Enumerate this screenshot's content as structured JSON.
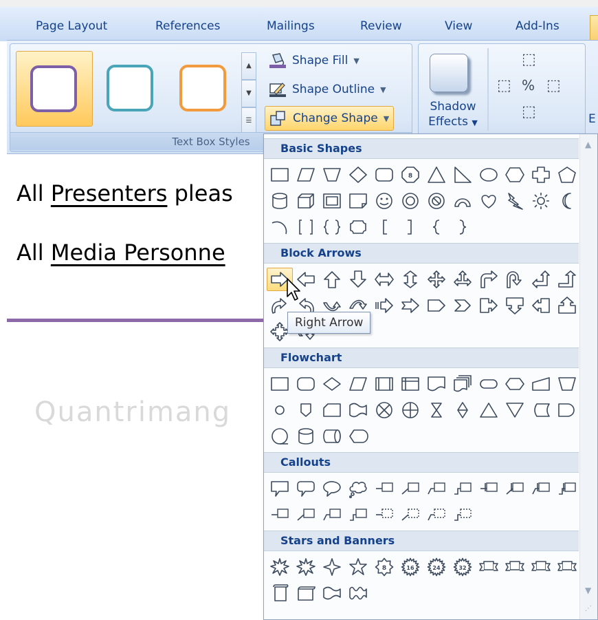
{
  "ribbon": {
    "tabs": [
      "Page Layout",
      "References",
      "Mailings",
      "Review",
      "View",
      "Add-Ins"
    ],
    "text_box_styles": {
      "label": "Text Box Styles",
      "thumbnails": [
        {
          "name": "purple-outline-style",
          "border": "#7d5fa8"
        },
        {
          "name": "teal-outline-style",
          "border": "#4aa5b8"
        },
        {
          "name": "orange-outline-style",
          "border": "#f29a3e"
        }
      ]
    },
    "commands": {
      "shape_fill": "Shape Fill",
      "shape_outline": "Shape Outline",
      "change_shape": "Change Shape"
    },
    "shadow": {
      "line1": "Shadow",
      "line2": "Effects"
    },
    "partial_label": "E"
  },
  "document": {
    "line1": {
      "prefix": "All ",
      "underlined": "Presenters",
      "rest": " pleas"
    },
    "line2": {
      "prefix": "All ",
      "underlined": "Media Personne",
      "rest": ""
    },
    "watermark": "Quantrimang"
  },
  "shape_menu": {
    "sections": [
      {
        "title": "Basic Shapes",
        "rows": [
          [
            "rect",
            "parallelogram",
            "trapezoid",
            "diamond",
            "rounded-rect",
            "octagon",
            "triangle",
            "right-triangle",
            "oval",
            "hexagon",
            "cross",
            "pentagon"
          ],
          [
            "can",
            "cube",
            "bevel",
            "folded-corner",
            "smiley",
            "donut",
            "no-symbol",
            "arc",
            "heart",
            "lightning",
            "sun",
            "moon"
          ],
          [
            "arc-open",
            "double-bracket",
            "double-brace",
            "plaque",
            "left-bracket",
            "right-bracket",
            "left-brace",
            "right-brace"
          ]
        ]
      },
      {
        "title": "Block Arrows",
        "rows": [
          [
            "right-arrow",
            "left-arrow",
            "up-arrow",
            "down-arrow",
            "left-right-arrow",
            "up-down-arrow",
            "quad-arrow",
            "left-right-up-arrow",
            "bent-arrow",
            "u-turn-arrow",
            "left-up-arrow",
            "bent-up-arrow"
          ],
          [
            "curved-right-arrow",
            "curved-left-arrow",
            "curved-up-arrow",
            "curved-down-arrow",
            "striped-right-arrow",
            "notched-right-arrow",
            "pentagon-arrow",
            "chevron",
            "right-arrow-callout",
            "down-arrow-callout",
            "left-arrow-callout",
            "up-arrow-callout"
          ],
          [
            "quad-arrow-callout",
            "circular-arrow"
          ]
        ]
      },
      {
        "title": "Flowchart",
        "rows": [
          [
            "process",
            "alternate-process",
            "decision",
            "data",
            "predefined-process",
            "internal-storage",
            "document",
            "multidocument",
            "terminator",
            "preparation",
            "manual-input",
            "manual-operation"
          ],
          [
            "connector",
            "off-page-connector",
            "card",
            "punched-tape",
            "summing-junction",
            "or",
            "collate",
            "sort",
            "extract",
            "merge",
            "stored-data",
            "delay"
          ],
          [
            "sequential-access",
            "magnetic-disk",
            "direct-access",
            "display"
          ]
        ]
      },
      {
        "title": "Callouts",
        "rows": [
          [
            "rect-callout",
            "rounded-callout",
            "oval-callout",
            "cloud-callout",
            "line-callout-1",
            "line-callout-2",
            "line-callout-3",
            "line-callout-4",
            "line-callout-1-accent",
            "line-callout-2-accent",
            "line-callout-3-accent",
            "line-callout-4-accent"
          ],
          [
            "line-callout-1-border",
            "line-callout-2-border",
            "line-callout-3-border",
            "line-callout-4-border",
            "line-callout-1-noborder",
            "line-callout-2-noborder",
            "line-callout-3-noborder",
            "line-callout-4-noborder"
          ]
        ]
      },
      {
        "title": "Stars and Banners",
        "rows": [
          [
            "explosion-1",
            "explosion-2",
            "star-4",
            "star-5",
            "star-8",
            "star-16",
            "star-24",
            "star-32",
            "up-ribbon",
            "down-ribbon",
            "curved-up-ribbon",
            "curved-down-ribbon"
          ],
          [
            "vertical-scroll",
            "horizontal-scroll",
            "wave",
            "double-wave"
          ]
        ]
      }
    ],
    "badges": {
      "star-8": "8",
      "star-16": "16",
      "star-24": "24",
      "star-32": "32",
      "octagon": "8"
    },
    "selected": "right-arrow",
    "tooltip": "Right Arrow"
  },
  "colors": {
    "accent": "#15428b",
    "shape_stroke": "#3c4a5e",
    "highlight": "#ffdc7c"
  }
}
